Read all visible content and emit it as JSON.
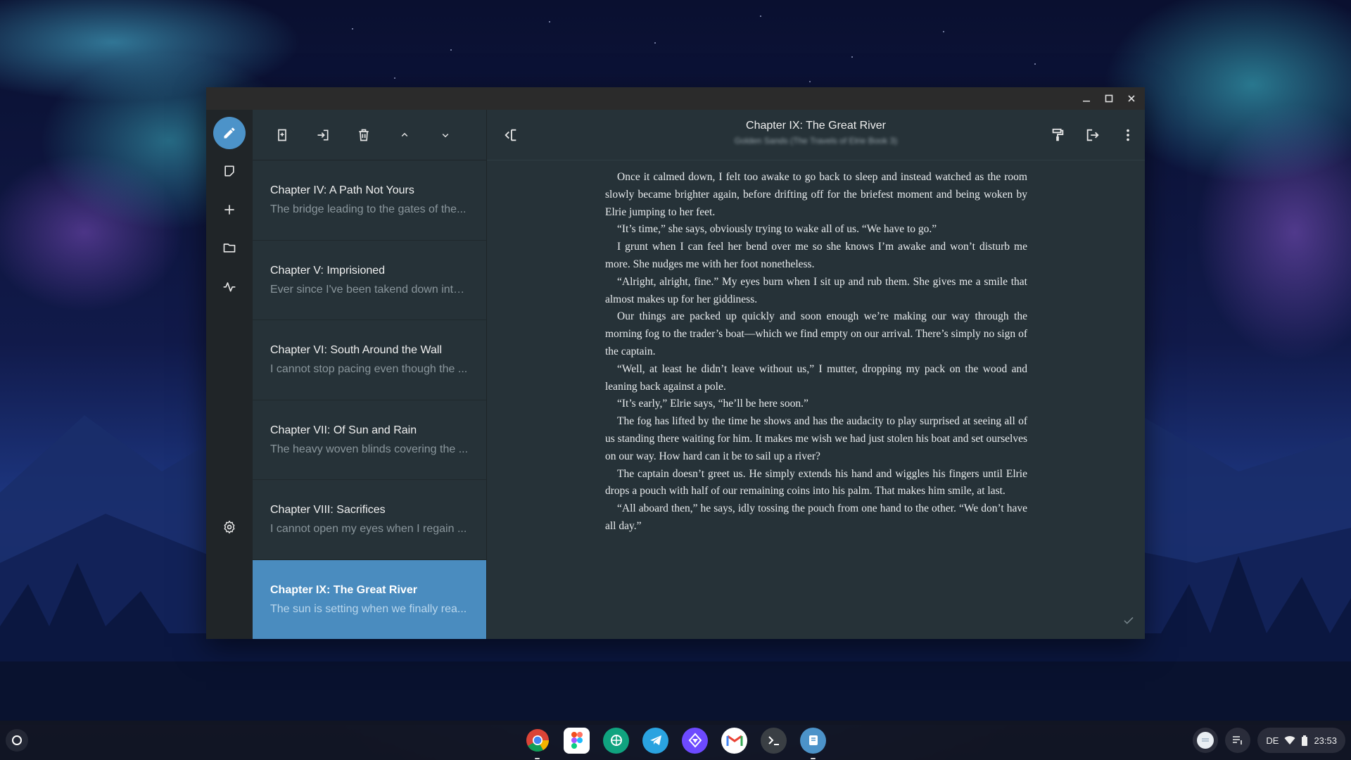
{
  "window": {
    "controls": [
      "minimize",
      "maximize",
      "close"
    ]
  },
  "rail": {
    "items": [
      {
        "name": "edit-pencil-icon",
        "active": true
      },
      {
        "name": "notes-icon",
        "active": false
      },
      {
        "name": "add-icon",
        "active": false
      },
      {
        "name": "folder-icon",
        "active": false
      },
      {
        "name": "statistics-icon",
        "active": false
      }
    ],
    "settings_icon": "gear-icon"
  },
  "list_toolbar": {
    "icons": [
      "add-chapter-icon",
      "import-icon",
      "delete-icon",
      "move-up-icon",
      "move-down-icon"
    ]
  },
  "chapters": [
    {
      "title": "Chapter IV: A Path Not Yours",
      "snippet": "The bridge leading to the gates of the...",
      "selected": false
    },
    {
      "title": "Chapter V: Imprisioned",
      "snippet": "Ever since I've been takend down into...",
      "selected": false
    },
    {
      "title": "Chapter VI: South Around the Wall",
      "snippet": "I cannot stop pacing even though the ...",
      "selected": false
    },
    {
      "title": "Chapter VII: Of Sun and Rain",
      "snippet": "The heavy woven blinds covering the ...",
      "selected": false
    },
    {
      "title": "Chapter VIII: Sacrifices",
      "snippet": "I cannot open my eyes when I regain ...",
      "selected": false
    },
    {
      "title": "Chapter IX: The Great River",
      "snippet": "The sun is setting when we finally rea...",
      "selected": true
    }
  ],
  "editor": {
    "title": "Chapter IX: The Great River",
    "subtitle": "Golden Sands (The Travels of Elrie Book 3)",
    "paragraphs": [
      "Once it calmed down, I felt too awake to go back to sleep and instead watched as the room slowly became brighter again, before drifting off for the briefest moment and being woken by Elrie jumping to her feet.",
      "“It’s time,” she says, obviously trying to wake all of us. “We have to go.”",
      "I grunt when I can feel her bend over me so she knows I’m awake and won’t disturb me more. She nudges me with her foot nonetheless.",
      "“Alright, alright, fine.” My eyes burn when I sit up and rub them. She gives me a smile that almost makes up for her giddiness.",
      "Our things are packed up quickly and soon enough we’re making our way through the morning fog to the trader’s boat—which we find empty on our arrival. There’s simply no sign of the captain.",
      "“Well, at least he didn’t leave without us,” I mutter, dropping my pack on the wood and leaning back against a pole.",
      "“It’s early,” Elrie says, “he’ll be here soon.”",
      "The fog has lifted by the time he shows and has the audacity to play surprised at seeing all of us standing there waiting for him. It makes me wish we had just stolen his boat and set ourselves on our way. How hard can it be to sail up a river?",
      "The captain doesn’t greet us. He simply extends his hand and wiggles his fingers until Elrie drops a pouch with half of our remaining coins into his palm. That makes him smile, at last.",
      "“All aboard then,” he says, idly tossing the pouch from one hand to the other. “We don’t have all day.”"
    ],
    "toolbar_icons": [
      "collapse-sidebar-icon",
      "format-paint-icon",
      "export-icon",
      "more-vert-icon"
    ]
  },
  "shelf": {
    "apps": [
      "chrome",
      "figma",
      "chatgpt",
      "telegram",
      "proton-vpn",
      "gmail",
      "terminal",
      "novelist"
    ],
    "keyboard_layout": "DE",
    "time": "23:53"
  },
  "colors": {
    "accent": "#4c93c9",
    "selected_row": "#4a8cbf",
    "panel": "#263238",
    "rail": "#202528"
  }
}
